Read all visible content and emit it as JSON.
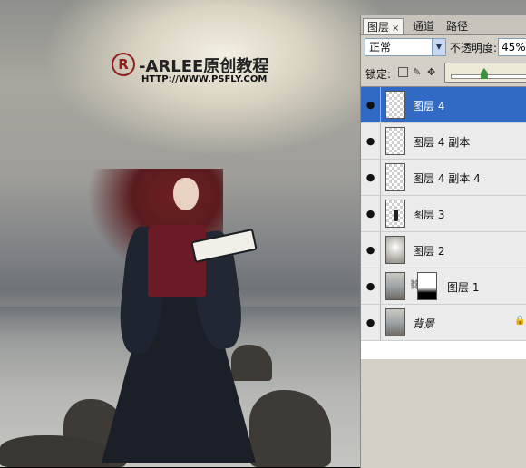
{
  "watermark": {
    "title": "-ARLEE原创教程",
    "url": "HTTP://WWW.PSFLY.COM"
  },
  "panel": {
    "tabs": [
      {
        "label": "图层",
        "active": true,
        "close": "×"
      },
      {
        "label": "通道",
        "active": false
      },
      {
        "label": "路径",
        "active": false
      }
    ],
    "blend_mode": "正常",
    "opacity_label": "不透明度:",
    "opacity_value": "45%",
    "opacity_fraction": 0.45,
    "lock_label": "锁定:",
    "layers": [
      {
        "name": "图层 4",
        "selected": true,
        "visible": true,
        "thumb": "transparent"
      },
      {
        "name": "图层 4 副本",
        "selected": false,
        "visible": true,
        "thumb": "transparent"
      },
      {
        "name": "图层 4 副本 4",
        "selected": false,
        "visible": true,
        "thumb": "transparent"
      },
      {
        "name": "图层 3",
        "selected": false,
        "visible": true,
        "thumb": "figure"
      },
      {
        "name": "图层 2",
        "selected": false,
        "visible": true,
        "thumb": "light"
      },
      {
        "name": "图层 1",
        "selected": false,
        "visible": true,
        "thumb": "photo",
        "mask": true
      },
      {
        "name": "背景",
        "selected": false,
        "visible": true,
        "thumb": "photo",
        "locked": true
      }
    ]
  },
  "colors": {
    "selection": "#316ac5",
    "watermark_r": "#8f2020"
  },
  "icons": {
    "visibility": "eye-icon",
    "lock": "lock-icon",
    "link": "chain-link-icon",
    "move": "move-icon"
  }
}
